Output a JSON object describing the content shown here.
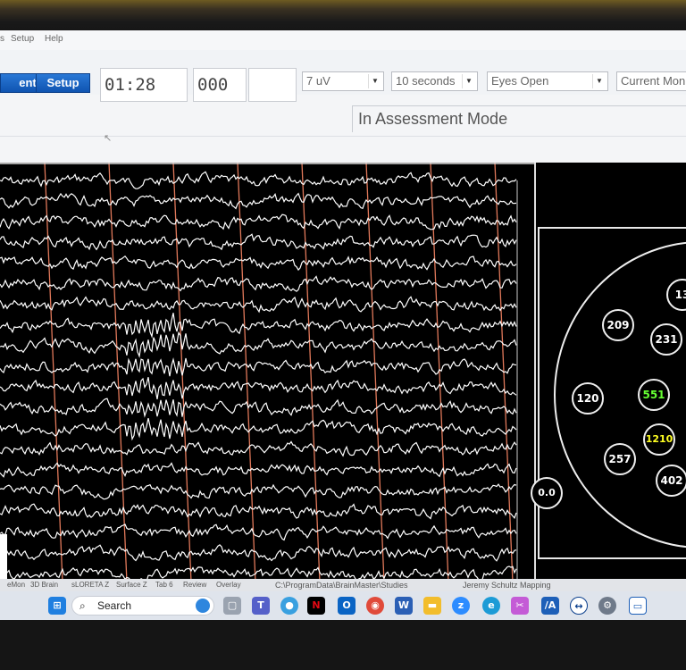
{
  "menu": {
    "items": [
      "s",
      "Setup",
      "Help"
    ]
  },
  "toolbar": {
    "buttons": [
      {
        "label": "ent"
      },
      {
        "label": "Setup"
      }
    ],
    "timer": "01:28",
    "counter": "000",
    "blank": "",
    "gain": "7 uV",
    "duration": "10 seconds",
    "condition": "Eyes Open",
    "current_mode_label": "Current Mon"
  },
  "status": {
    "mode": "In Assessment Mode"
  },
  "eeg": {
    "traces": 20,
    "markers": 8,
    "trace_color": "#ffffff",
    "marker_color": "#e0785a"
  },
  "headmap": {
    "values": [
      "13",
      "209",
      "231",
      "120",
      "551",
      "1210",
      "257",
      "402",
      "0.0"
    ],
    "highlight_green": "#66ff33",
    "highlight_yellow": "#ffff22"
  },
  "tabs": {
    "items": [
      "eMon",
      "3D Brain",
      "sLORETA Z",
      "Surface Z",
      "Tab 6",
      "Review",
      "Overlay"
    ],
    "path": "C:\\ProgramData\\BrainMaster\\Studies",
    "user": "Jeremy Schultz Mapping"
  },
  "taskbar": {
    "search_label": "Search",
    "icons": [
      "windows-icon",
      "task-view-icon",
      "teams-icon",
      "app-icon",
      "netflix-icon",
      "outlook-icon",
      "chrome-icon",
      "word-icon",
      "folder-icon",
      "zoom-icon",
      "edge-icon",
      "snip-icon",
      "brainmaster-icon",
      "teamviewer-icon",
      "settings-icon",
      "app-window-icon"
    ]
  }
}
